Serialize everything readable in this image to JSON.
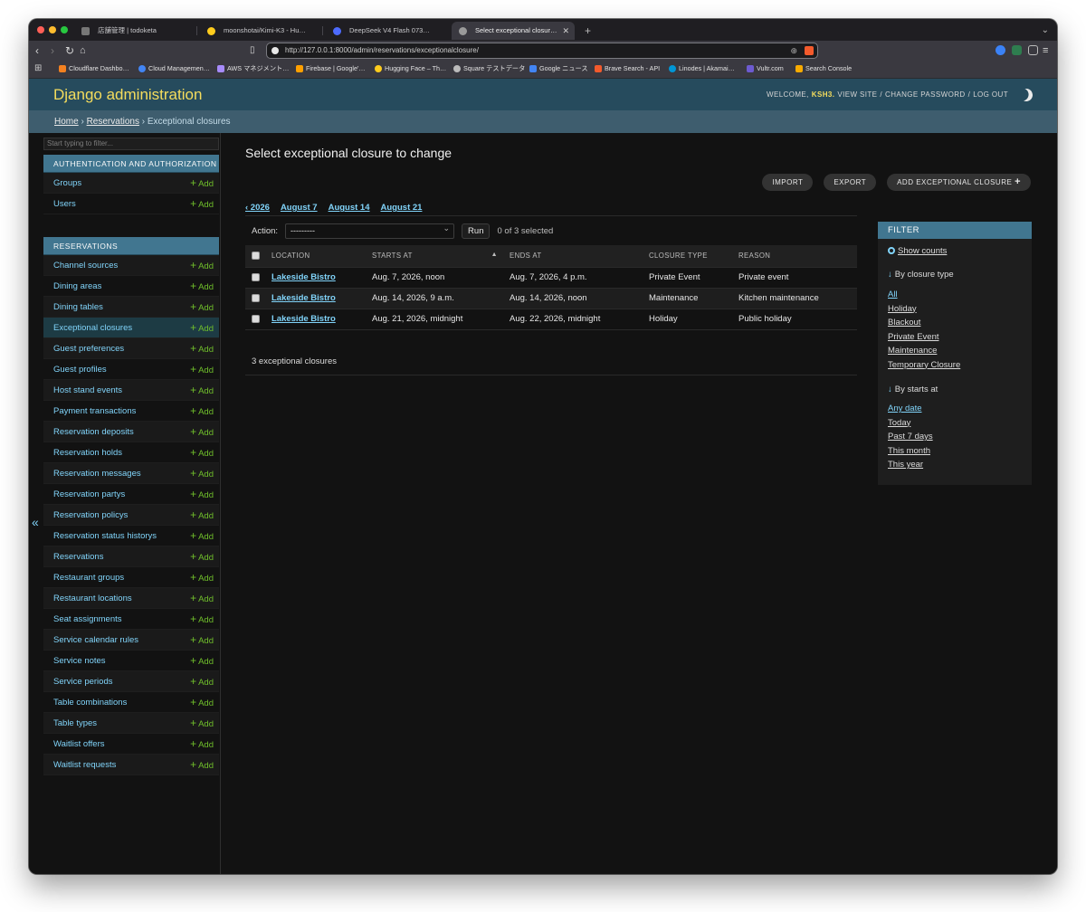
{
  "browser": {
    "tabs": [
      {
        "title": "店舗管理 | todoketa",
        "active": false
      },
      {
        "title": "moonshotai/Kimi-K3 - Hugging Face",
        "active": false
      },
      {
        "title": "DeepSeek V4 Flash 0731をRTX PRO",
        "active": false
      },
      {
        "title": "Select exceptional closure to change",
        "active": true
      }
    ],
    "url": "http://127.0.0.1:8000/admin/reservations/exceptionalclosure/",
    "bookmarks": [
      "Cloudflare Dashbo…",
      "Cloud Managemen…",
      "AWS マネジメント…",
      "Firebase | Google'…",
      "Hugging Face – Th…",
      "Square テストデータ",
      "Google ニュース",
      "Brave Search - API",
      "Linodes | Akamai…",
      "Vultr.com",
      "Search Console"
    ]
  },
  "header": {
    "brand": "Django administration",
    "welcome": "Welcome,",
    "username": "ksh3.",
    "view_site": "View site",
    "change_password": "Change password",
    "log_out": "Log out"
  },
  "breadcrumbs": {
    "home": "Home",
    "app": "Reservations",
    "current": "Exceptional closures"
  },
  "sidebar": {
    "filter_placeholder": "Start typing to filter...",
    "add_label": "Add",
    "auth": {
      "caption": "Authentication and Authorization",
      "models": [
        "Groups",
        "Users"
      ]
    },
    "reservations": {
      "caption": "Reservations",
      "models": [
        "Channel sources",
        "Dining areas",
        "Dining tables",
        "Exceptional closures",
        "Guest preferences",
        "Guest profiles",
        "Host stand events",
        "Payment transactions",
        "Reservation deposits",
        "Reservation holds",
        "Reservation messages",
        "Reservation partys",
        "Reservation policys",
        "Reservation status historys",
        "Reservations",
        "Restaurant groups",
        "Restaurant locations",
        "Seat assignments",
        "Service calendar rules",
        "Service notes",
        "Service periods",
        "Table combinations",
        "Table types",
        "Waitlist offers",
        "Waitlist requests"
      ]
    }
  },
  "main": {
    "title": "Select exceptional closure to change",
    "tools": {
      "import": "Import",
      "export": "Export",
      "add": "Add exceptional closure"
    },
    "date_hierarchy": {
      "back": "‹ 2026",
      "links": [
        "August 7",
        "August 14",
        "August 21"
      ]
    },
    "actions": {
      "label": "Action:",
      "selected": "---------",
      "run": "Run",
      "count": "0 of 3 selected"
    },
    "table": {
      "columns": [
        "Location",
        "Starts at",
        "Ends at",
        "Closure type",
        "Reason"
      ],
      "rows": [
        [
          "Lakeside Bistro",
          "Aug. 7, 2026, noon",
          "Aug. 7, 2026, 4 p.m.",
          "Private Event",
          "Private event"
        ],
        [
          "Lakeside Bistro",
          "Aug. 14, 2026, 9 a.m.",
          "Aug. 14, 2026, noon",
          "Maintenance",
          "Kitchen maintenance"
        ],
        [
          "Lakeside Bistro",
          "Aug. 21, 2026, midnight",
          "Aug. 22, 2026, midnight",
          "Holiday",
          "Public holiday"
        ]
      ]
    },
    "paginator": "3 exceptional closures"
  },
  "filter": {
    "title": "Filter",
    "show_counts": "Show counts",
    "closure_type": {
      "title": "By closure type",
      "options": [
        "All",
        "Holiday",
        "Blackout",
        "Private Event",
        "Maintenance",
        "Temporary Closure"
      ]
    },
    "starts_at": {
      "title": "By starts at",
      "options": [
        "Any date",
        "Today",
        "Past 7 days",
        "This month",
        "This year"
      ]
    }
  },
  "colors": {
    "header": "#264b5d",
    "brand": "#f5dd5d",
    "accent": "#417690",
    "link": "#81d4fa",
    "add": "#70bf2b"
  }
}
